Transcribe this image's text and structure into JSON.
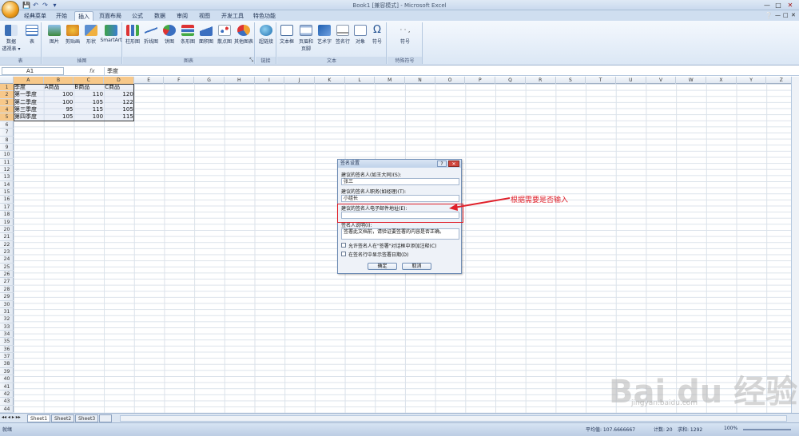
{
  "window": {
    "title": "Book1 [兼容模式] - Microsoft Excel",
    "qat": [
      "💾",
      "↶",
      "↷",
      "▾"
    ],
    "controls": [
      "—",
      "□",
      "✕"
    ],
    "help_icons": [
      "❔",
      "—",
      "□",
      "✕"
    ]
  },
  "tabs": [
    "经典菜单",
    "开始",
    "插入",
    "页面布局",
    "公式",
    "数据",
    "审阅",
    "视图",
    "开发工具",
    "特色功能"
  ],
  "active_tab": "插入",
  "ribbon": {
    "groups": [
      {
        "label": "表",
        "buttons": [
          "数据\n透视表 ▾",
          "表"
        ]
      },
      {
        "label": "插图",
        "buttons": [
          "图片",
          "剪贴画",
          "形状",
          "SmartArt"
        ]
      },
      {
        "label": "图表",
        "buttons": [
          "柱形图",
          "折线图",
          "饼图",
          "条形图",
          "面积图",
          "散点图",
          "其他图表"
        ]
      },
      {
        "label": "链接",
        "buttons": [
          "超链接"
        ]
      },
      {
        "label": "文本",
        "buttons": [
          "文本框",
          "页眉和\n页脚",
          "艺术字",
          "签名行",
          "对象",
          "符号"
        ]
      },
      {
        "label": "特殊符号",
        "buttons": [
          "符号"
        ]
      }
    ],
    "dialog_launcher": "⤡"
  },
  "formula_bar": {
    "name_box": "A1",
    "fx": "fx",
    "content": "季度"
  },
  "columns": [
    "A",
    "B",
    "C",
    "D",
    "E",
    "F",
    "G",
    "H",
    "I",
    "J",
    "K",
    "L",
    "M",
    "N",
    "O",
    "P",
    "Q",
    "R",
    "S",
    "T",
    "U",
    "V",
    "W",
    "X",
    "Y",
    "Z"
  ],
  "rows": [
    "1",
    "2",
    "3",
    "4",
    "5",
    "6",
    "7",
    "8",
    "9",
    "10",
    "11",
    "12",
    "13",
    "14",
    "15",
    "16",
    "17",
    "18",
    "19",
    "20",
    "21",
    "22",
    "23",
    "24",
    "25",
    "26",
    "27",
    "28",
    "29",
    "30",
    "31",
    "32",
    "33",
    "34",
    "35",
    "36",
    "37",
    "38",
    "39",
    "40",
    "41",
    "42",
    "43",
    "44"
  ],
  "table": {
    "headers": [
      "季度",
      "A商品",
      "B商品",
      "C商品"
    ],
    "rows": [
      [
        "第一季度",
        "100",
        "110",
        "120"
      ],
      [
        "第二季度",
        "100",
        "105",
        "122"
      ],
      [
        "第三季度",
        "95",
        "115",
        "105"
      ],
      [
        "第四季度",
        "105",
        "100",
        "115"
      ]
    ]
  },
  "sheets": [
    "Sheet1",
    "Sheet2",
    "Sheet3"
  ],
  "sheet_nav": "◂◂ ◂ ▸ ▸▸",
  "status": {
    "mode": "就绪",
    "average": "平均值: 107.6666667",
    "count": "计数: 20",
    "sum": "求和: 1292",
    "zoom": "100%"
  },
  "dialog": {
    "title": "签名设置",
    "fields": [
      {
        "label": "建议的签名人(如王大同)(S):",
        "value": "张三"
      },
      {
        "label": "建议的签名人职务(如经理)(T):",
        "value": "小组长"
      },
      {
        "label": "建议的签名人电子邮件地址(E):",
        "value": ""
      },
      {
        "label": "签名人说明(I):",
        "value": "签署此文档前，请验证要签署的内容是否正确。"
      }
    ],
    "checkboxes": [
      "允许签名人在\"签署\"对话框中添加注释(C)",
      "在签名行中显示签署日期(D)"
    ],
    "ok": "确定",
    "cancel": "取消",
    "help": "?",
    "close": "✕"
  },
  "annotation": "根据需要是否输入",
  "watermark": {
    "text": "Bai du 经验",
    "url": "jingyan.baidu.com"
  },
  "colors": {
    "accent": "#f7c88a",
    "highlight": "#e0202a"
  }
}
